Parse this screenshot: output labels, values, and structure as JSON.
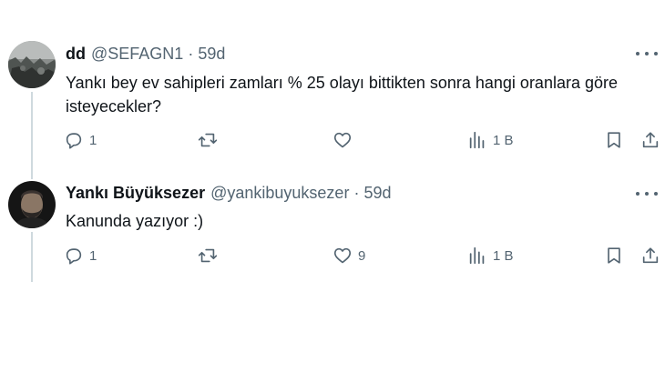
{
  "reply1": {
    "name": "dd",
    "handle": "@SEFAGN1",
    "separator": "·",
    "time": "59d",
    "text": "Yankı bey ev sahipleri zamları % 25 olayı bittikten sonra hangi oranlara göre isteyecekler?",
    "replies": "1",
    "retweets": "",
    "likes": "",
    "views": "1 B"
  },
  "reply2": {
    "name": "Yankı Büyüksezer",
    "handle": "@yankibuyuksezer",
    "separator": "·",
    "time": "59d",
    "text": "Kanunda yazıyor :)",
    "replies": "1",
    "retweets": "",
    "likes": "9",
    "views": "1 B"
  },
  "icons": {
    "more": "more-icon",
    "reply": "reply-icon",
    "retweet": "retweet-icon",
    "like": "heart-icon",
    "views": "views-icon",
    "bookmark": "bookmark-icon",
    "share": "share-icon"
  },
  "colors": {
    "text": "#0f1419",
    "secondary": "#536471",
    "thread_line": "#cfd9de"
  }
}
